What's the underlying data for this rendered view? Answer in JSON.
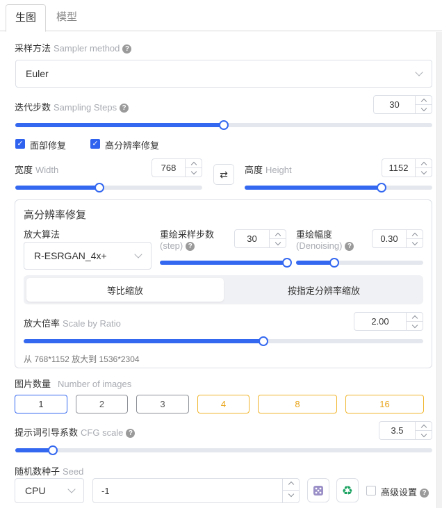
{
  "tabs": [
    {
      "label": "生图",
      "active": true
    },
    {
      "label": "模型",
      "active": false
    }
  ],
  "sampler": {
    "label": "采样方法",
    "label_en": "Sampler method",
    "value": "Euler"
  },
  "steps": {
    "label": "迭代步数",
    "label_en": "Sampling Steps",
    "value": "30",
    "level": 0.5
  },
  "checkboxes": {
    "face": "面部修复",
    "hires": "高分辨率修复"
  },
  "width": {
    "label": "宽度",
    "label_en": "Width",
    "value": "768",
    "level": 0.45
  },
  "height": {
    "label": "高度",
    "label_en": "Height",
    "value": "1152",
    "level": 0.73
  },
  "swap_icon": "swap-arrows-icon",
  "hires": {
    "title": "高分辨率修复",
    "upscaler_label": "放大算法",
    "upscaler_value": "R-ESRGAN_4x+",
    "redraw_steps_label": "重绘采样步数",
    "redraw_steps_en": "(step)",
    "redraw_steps_value": "30",
    "redraw_steps_level": 1.0,
    "denoise_label": "重绘幅度",
    "denoise_en": "(Denoising)",
    "denoise_value": "0.30",
    "denoise_level": 0.3,
    "mode_ratio": "等比缩放",
    "mode_resolution": "按指定分辨率缩放",
    "scale_label": "放大倍率",
    "scale_en": "Scale by Ratio",
    "scale_value": "2.00",
    "scale_level": 0.6,
    "summary": "从 768*1152 放大到 1536*2304"
  },
  "images": {
    "label": "图片数量",
    "label_en": "Number of images",
    "options": [
      "1",
      "2",
      "3",
      "4",
      "8",
      "16"
    ],
    "selected": "1"
  },
  "cfg": {
    "label": "提示词引导系数",
    "label_en": "CFG scale",
    "value": "3.5",
    "level": 0.09
  },
  "seed": {
    "label": "随机数种子",
    "label_en": "Seed",
    "device": "CPU",
    "value": "-1"
  },
  "advanced_label": "高级设置",
  "colors": {
    "accent": "#3468f0",
    "gold": "#f0b429",
    "recycle": "#1aa260"
  }
}
